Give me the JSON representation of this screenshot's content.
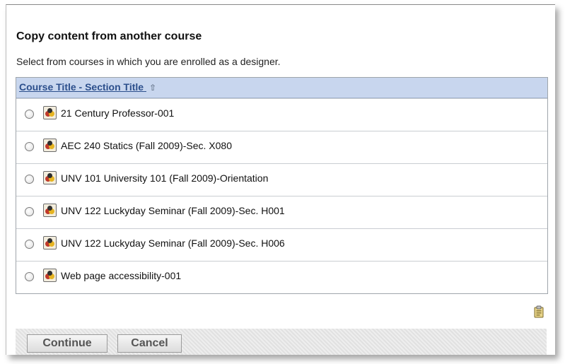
{
  "dialog": {
    "title": "Copy content from another course",
    "subtitle": "Select from courses in which you are enrolled as a designer."
  },
  "table": {
    "header": "Course Title - Section Title",
    "sort_icon": "sort-ascending-icon",
    "rows": [
      {
        "label": "21 Century Professor-001",
        "selected": false
      },
      {
        "label": "AEC 240 Statics (Fall 2009)-Sec. X080",
        "selected": false
      },
      {
        "label": "UNV 101 University 101 (Fall 2009)-Orientation",
        "selected": false
      },
      {
        "label": "UNV 122 Luckyday Seminar (Fall 2009)-Sec. H001",
        "selected": false
      },
      {
        "label": "UNV 122 Luckyday Seminar (Fall 2009)-Sec. H006",
        "selected": false
      },
      {
        "label": "Web page accessibility-001",
        "selected": false
      }
    ]
  },
  "help_icon": "help-clipboard-icon",
  "buttons": {
    "continue_label": "Continue",
    "cancel_label": "Cancel"
  },
  "colors": {
    "header_bg": "#c8d6ee",
    "header_link": "#2c4f8c",
    "button_bar_bg": "#e8e8e8"
  }
}
